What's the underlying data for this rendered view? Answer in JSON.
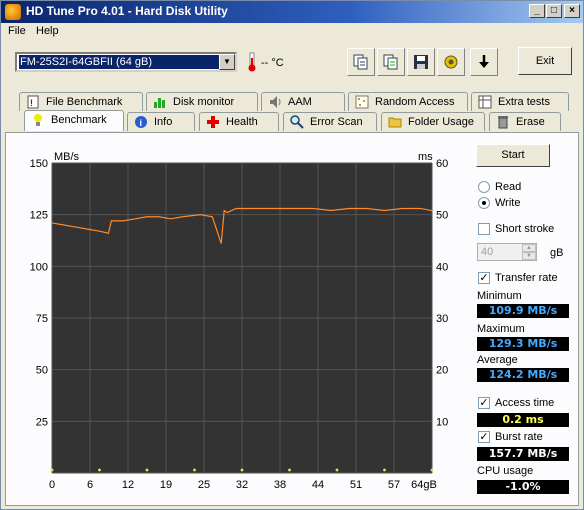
{
  "window": {
    "title": "HD Tune Pro 4.01 - Hard Disk Utility",
    "min": "_",
    "max": "□",
    "close": "×"
  },
  "menu": {
    "file": "File",
    "help": "Help"
  },
  "toolbar": {
    "drive": "FM-25S2I-64GBFII (64 gB)",
    "temperature": "-- °C",
    "exit": "Exit"
  },
  "tabs_top": [
    {
      "label": "File Benchmark",
      "icon": "document-icon"
    },
    {
      "label": "Disk monitor",
      "icon": "bar-chart-icon"
    },
    {
      "label": "AAM",
      "icon": "speaker-icon"
    },
    {
      "label": "Random Access",
      "icon": "dots-icon"
    },
    {
      "label": "Extra tests",
      "icon": "grid-icon"
    }
  ],
  "tabs_bottom": [
    {
      "label": "Benchmark",
      "icon": "bulb-icon"
    },
    {
      "label": "Info",
      "icon": "info-icon"
    },
    {
      "label": "Health",
      "icon": "cross-icon"
    },
    {
      "label": "Error Scan",
      "icon": "magnifier-icon"
    },
    {
      "label": "Folder Usage",
      "icon": "folder-icon"
    },
    {
      "label": "Erase",
      "icon": "trash-icon"
    }
  ],
  "side": {
    "start": "Start",
    "read": "Read",
    "write": "Write",
    "short_stroke": "Short stroke",
    "stroke_value": "40",
    "stroke_unit": "gB",
    "transfer_rate": "Transfer rate",
    "minimum_label": "Minimum",
    "minimum": "109.9 MB/s",
    "maximum_label": "Maximum",
    "maximum": "129.3 MB/s",
    "average_label": "Average",
    "average": "124.2 MB/s",
    "access_time": "Access time",
    "access_value": "0.2 ms",
    "burst_rate": "Burst rate",
    "burst_value": "157.7 MB/s",
    "cpu_label": "CPU usage",
    "cpu_value": "-1.0%"
  },
  "colors": {
    "transfer": "#ff8a2a",
    "access": "#e8e840",
    "readout_blue": "#44aaff",
    "readout_yellow": "#ffff55",
    "readout_white": "#ffffff"
  },
  "chart_data": {
    "type": "line",
    "left_unit": "MB/s",
    "right_unit": "ms",
    "x_ticks": [
      "0",
      "6",
      "12",
      "19",
      "25",
      "32",
      "38",
      "44",
      "51",
      "57",
      "64gB"
    ],
    "y_ticks_left": [
      "150",
      "125",
      "100",
      "75",
      "50",
      "25"
    ],
    "y_ticks_right": [
      "60",
      "50",
      "40",
      "30",
      "20",
      "10"
    ],
    "xlim": [
      0,
      64
    ],
    "ylim_left": [
      0,
      150
    ],
    "ylim_right": [
      0,
      60
    ],
    "grid": true,
    "series": [
      {
        "name": "Transfer rate",
        "axis": "left",
        "x": [
          0,
          2,
          4,
          6,
          8,
          9.5,
          10,
          12,
          14,
          16,
          18,
          20,
          22,
          25,
          27,
          28.5,
          29,
          29.5,
          31,
          33,
          35,
          38,
          41,
          44,
          47,
          50,
          53,
          56,
          59,
          62,
          64
        ],
        "y": [
          121,
          120,
          119,
          118,
          117,
          116,
          122,
          122,
          123,
          124,
          124,
          123,
          124,
          125,
          124,
          111,
          127,
          126,
          128,
          128,
          128,
          128,
          128,
          128,
          127,
          128,
          128,
          127,
          128,
          128,
          127
        ]
      },
      {
        "name": "Access time",
        "axis": "right",
        "x": [
          0,
          8,
          16,
          24,
          32,
          40,
          48,
          56,
          64
        ],
        "y": [
          0.2,
          0.2,
          0.2,
          0.2,
          0.2,
          0.2,
          0.2,
          0.2,
          0.2
        ]
      }
    ]
  }
}
